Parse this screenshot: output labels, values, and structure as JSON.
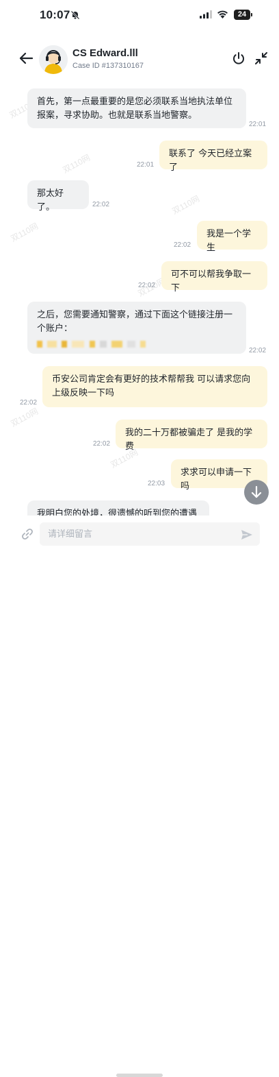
{
  "status_bar": {
    "time": "10:07",
    "battery": "24"
  },
  "header": {
    "agent_name": "CS Edward.lll",
    "case_id": "Case ID #137310167"
  },
  "watermark": "双110网",
  "messages": [
    {
      "from": "agent",
      "text": "首先，第一点最重要的是您必须联系当地执法单位报案，寻求协助。也就是联系当地警察。",
      "time": "22:01"
    },
    {
      "from": "user",
      "text": "联系了 今天已经立案了",
      "time": "22:01"
    },
    {
      "from": "agent",
      "text": "那太好了。",
      "time": "22:02"
    },
    {
      "from": "user",
      "text": "我是一个学生",
      "time": "22:02"
    },
    {
      "from": "user",
      "text": "可不可以帮我争取一下",
      "time": "22:02"
    },
    {
      "from": "agent",
      "text": "之后，您需要通知警察，通过下面这个链接注册一个账户：",
      "time": "22:02"
    },
    {
      "from": "user",
      "text": "币安公司肯定会有更好的技术帮帮我 可以请求您向上级反映一下吗",
      "time": "22:02"
    },
    {
      "from": "user",
      "text": "我的二十万都被骗走了 是我的学费",
      "time": "22:02"
    },
    {
      "from": "user",
      "text": "求求可以申请一下吗",
      "time": "22:03"
    },
    {
      "from": "agent",
      "text": "我明白您的处境，很遗憾的听到您的遭遇",
      "time": ""
    }
  ],
  "composer": {
    "placeholder": "请详细留言"
  },
  "colors": {
    "agent_bubble": "#f0f1f2",
    "user_bubble": "#fdf6dc",
    "accent": "#f0b90b"
  }
}
